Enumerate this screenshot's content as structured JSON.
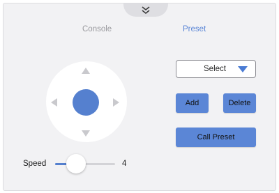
{
  "tabs": [
    {
      "label": "Console",
      "active": false
    },
    {
      "label": "Preset",
      "active": true
    }
  ],
  "collapse_icon": "double-chevron-down-icon",
  "joystick": {
    "arrows": [
      "triangle-up-icon",
      "triangle-down-icon",
      "triangle-left-icon",
      "triangle-right-icon"
    ]
  },
  "speed": {
    "label": "Speed",
    "value": "4",
    "slider_fraction": 0.35
  },
  "preset": {
    "select_value": "Select",
    "add_label": "Add",
    "delete_label": "Delete",
    "call_label": "Call Preset"
  },
  "colors": {
    "accent": "#5b86d6",
    "knob": "#5580cf",
    "panel": "#f2f2f4",
    "inactive_text": "#9a9a9e"
  }
}
